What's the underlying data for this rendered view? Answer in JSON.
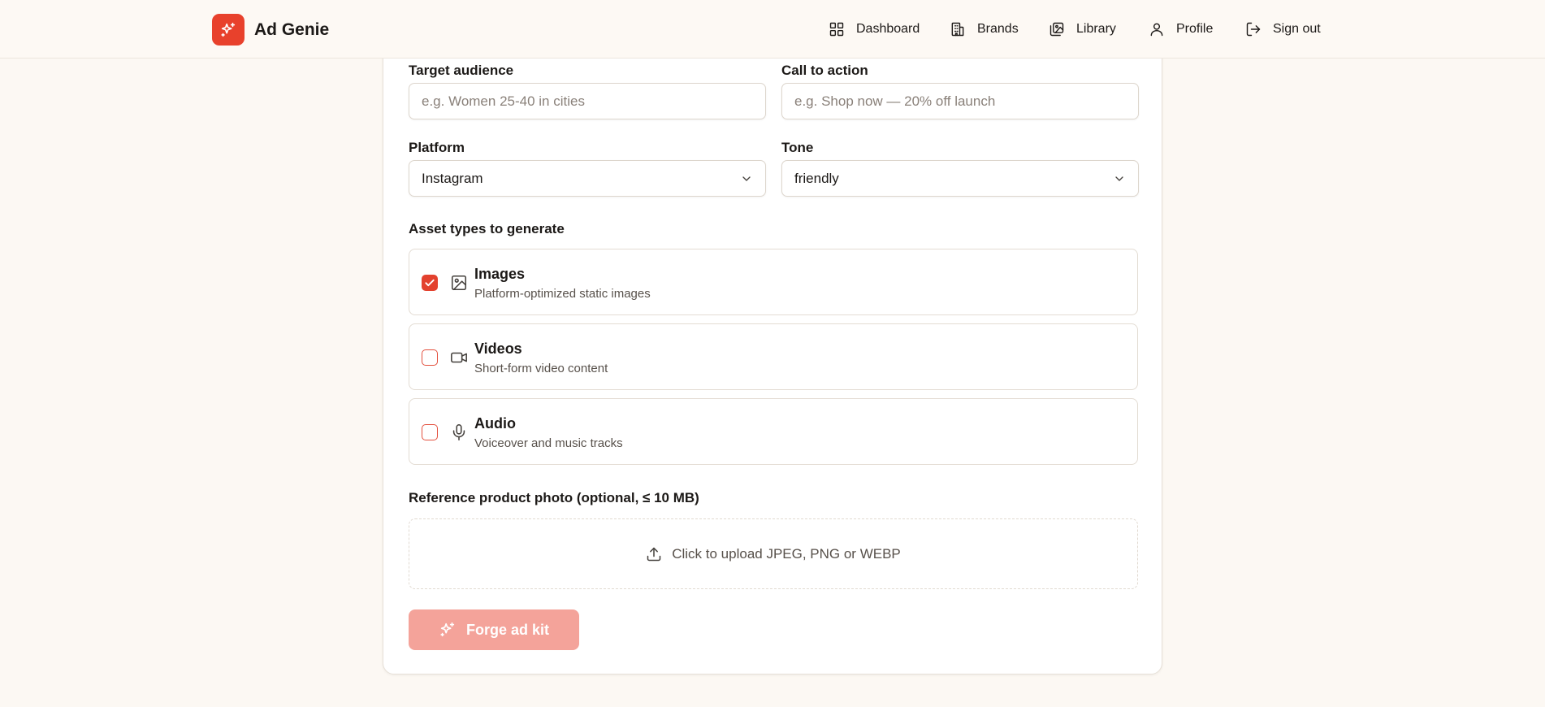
{
  "app": {
    "name": "Ad Genie",
    "logo_icon": "sparkles-icon",
    "accent": "#e8412c"
  },
  "nav": [
    {
      "label": "Dashboard",
      "icon": "grid-icon"
    },
    {
      "label": "Brands",
      "icon": "building-icon"
    },
    {
      "label": "Library",
      "icon": "images-icon"
    },
    {
      "label": "Profile",
      "icon": "user-icon"
    },
    {
      "label": "Sign out",
      "icon": "sign-out-icon"
    }
  ],
  "form": {
    "target_audience": {
      "label": "Target audience",
      "value": "",
      "placeholder": "e.g. Women 25-40 in cities"
    },
    "call_to_action": {
      "label": "Call to action",
      "value": "",
      "placeholder": "e.g. Shop now — 20% off launch"
    },
    "platform": {
      "label": "Platform",
      "selected": "Instagram"
    },
    "tone": {
      "label": "Tone",
      "selected": "friendly"
    },
    "asset_types_label": "Asset types to generate",
    "asset_types": [
      {
        "title": "Images",
        "description": "Platform-optimized static images",
        "checked": true,
        "icon": "image-icon"
      },
      {
        "title": "Videos",
        "description": "Short-form video content",
        "checked": false,
        "icon": "video-icon"
      },
      {
        "title": "Audio",
        "description": "Voiceover and music tracks",
        "checked": false,
        "icon": "microphone-icon"
      }
    ],
    "reference_photo": {
      "label": "Reference product photo (optional, ≤ 10 MB)",
      "upload_text": "Click to upload JPEG, PNG or WEBP",
      "icon": "upload-icon"
    },
    "submit": {
      "label": "Forge ad kit",
      "icon": "sparkles-icon",
      "disabled": true
    }
  }
}
